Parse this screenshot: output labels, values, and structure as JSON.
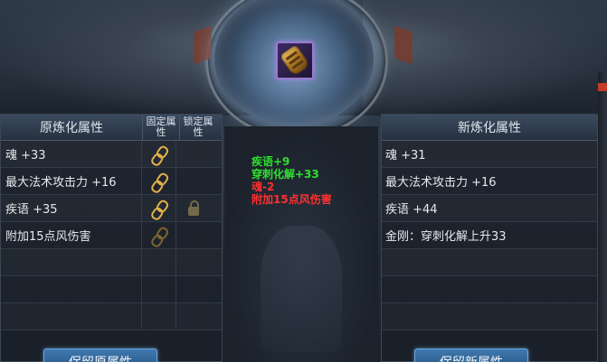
{
  "left_panel": {
    "title": "原炼化属性",
    "col_fixed": "固定属性",
    "col_lock": "锁定属性",
    "rows": [
      {
        "text": "魂 +33",
        "fixed": "chain-icon",
        "lock": ""
      },
      {
        "text": "最大法术攻击力 +16",
        "fixed": "chain-icon",
        "lock": ""
      },
      {
        "text": "疾语 +35",
        "fixed": "chain-icon",
        "lock": "lock-icon"
      },
      {
        "text": "附加15点风伤害",
        "fixed": "chain-icon",
        "lock": ""
      },
      {
        "text": "",
        "fixed": "",
        "lock": ""
      },
      {
        "text": "",
        "fixed": "",
        "lock": ""
      },
      {
        "text": "",
        "fixed": "",
        "lock": ""
      }
    ]
  },
  "right_panel": {
    "title": "新炼化属性",
    "rows": [
      {
        "text": "魂 +31"
      },
      {
        "text": "最大法术攻击力 +16"
      },
      {
        "text": "疾语 +44"
      },
      {
        "text": "金刚：穿刺化解上升33"
      },
      {
        "text": ""
      },
      {
        "text": ""
      },
      {
        "text": ""
      }
    ]
  },
  "differences": [
    {
      "text": "疾语+9",
      "kind": "positive"
    },
    {
      "text": "穿刺化解+33",
      "kind": "positive"
    },
    {
      "text": "魂-2",
      "kind": "negative"
    },
    {
      "text": "附加15点风伤害",
      "kind": "negative"
    }
  ],
  "buttons": {
    "keep_old": "保留原属性",
    "keep_new": "保留新属性"
  },
  "item": {
    "icon": "gauntlet-icon"
  },
  "colors": {
    "positive": "#2fe02f",
    "negative": "#ff3030",
    "accent": "#e2b248"
  }
}
